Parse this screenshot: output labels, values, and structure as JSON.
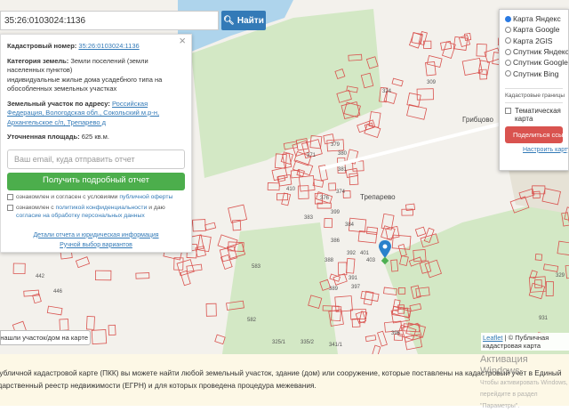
{
  "search": {
    "value": "35:26:0103024:1136",
    "button": "Найти",
    "icon": "search-icon"
  },
  "popup": {
    "cadastral_label": "Кадастровый номер:",
    "cadastral_value": "35:26:0103024:1136",
    "category_label": "Категория земель:",
    "category_value": "Земли поселений (земли населенных пунктов)",
    "use": "индивидуальные жилые дома усадебного типа на обособленных земельных участках",
    "address_label": "Земельный участок по адресу:",
    "address_value": "Российская Федерация, Вологодская обл., Сокольский м.р-н, Архангельское с/п, Трепарево д",
    "area_label": "Уточненная площадь:",
    "area_value": "625 кв.м.",
    "email_placeholder": "Ваш email, куда отправить отчет",
    "report_button": "Получить подробный отчет",
    "check1_text": "ознакомлен и согласен с условиями ",
    "check1_link": "публичной оферты",
    "check2_text": "ознакомлен с ",
    "check2_link": "политикой конфиденциальности",
    "check2_text2": " и даю ",
    "check2_link2": "согласие на обработку персональных данных",
    "details_link": "Детали отчета и юридическая информация",
    "manual_link": "Ручной выбор вариантов"
  },
  "layers": {
    "options": [
      {
        "label": "Карта Яндекс",
        "selected": true
      },
      {
        "label": "Карта Google",
        "selected": false
      },
      {
        "label": "Карта 2GIS",
        "selected": false
      },
      {
        "label": "Спутник Яндекс",
        "selected": false
      },
      {
        "label": "Спутник Google",
        "selected": false
      },
      {
        "label": "Спутник Bing",
        "selected": false
      }
    ],
    "select": "Кадастровые границы",
    "thematic": "Тематическая карта",
    "share": "Поделиться ссылкой",
    "configure": "Настроить карту"
  },
  "map": {
    "places": [
      "Трепарево",
      "Грибцово"
    ],
    "parcels": [
      "379",
      "371",
      "380",
      "381",
      "374",
      "376",
      "383",
      "399",
      "386",
      "388",
      "392",
      "401",
      "403",
      "389",
      "391",
      "397",
      "583",
      "582",
      "335/2",
      "325/1",
      "341/1",
      "931",
      "329",
      "309",
      "324",
      "396",
      "384",
      "410",
      "446",
      "442"
    ],
    "not_found": "Не нашли участок/дом на карте?",
    "attribution_link": "Leaflet",
    "attribution": " | © Публичная кадастровая карта"
  },
  "info": {
    "line1": "На публичной кадастровой карте (ПКК) вы можете найти любой земельный участок, здание (дом) или сооружение, которые поставлены на кадастровый учёт в Единый",
    "line2": "государственный реестр недвижимости (ЕГРН) и для которых проведена процедура межевания."
  },
  "watermark": {
    "title": "Активация Windows",
    "sub": "Чтобы активировать Windows, перейдите в раздел \"Параметры\"."
  }
}
